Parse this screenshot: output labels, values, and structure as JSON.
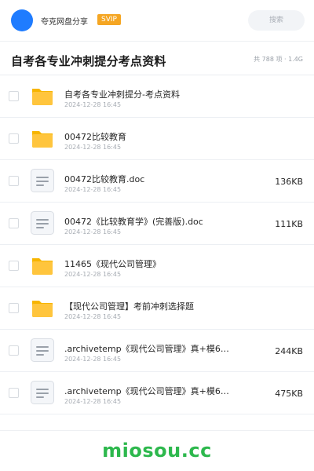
{
  "header": {
    "brand": "夸克网盘分享",
    "badge": "SVIP",
    "search_placeholder": "搜索"
  },
  "page": {
    "title": "自考各专业冲刺提分考点资料",
    "summary": "共 788 项 · 1.4G"
  },
  "files": [
    {
      "type": "folder",
      "name": "自考各专业冲刺提分-考点资料",
      "date": "2024-12-28 16:45",
      "size": ""
    },
    {
      "type": "folder",
      "name": "00472比较教育",
      "date": "2024-12-28 16:45",
      "size": ""
    },
    {
      "type": "file",
      "name": "00472比较教育.doc",
      "date": "2024-12-28 16:45",
      "size": "136KB"
    },
    {
      "type": "file",
      "name": "00472《比较教育学》(完善版).doc",
      "date": "2024-12-28 16:45",
      "size": "111KB"
    },
    {
      "type": "folder",
      "name": "11465《现代公司管理》",
      "date": "2024-12-28 16:45",
      "size": ""
    },
    {
      "type": "folder",
      "name": "【现代公司管理】考前冲刺选择题",
      "date": "2024-12-28 16:45",
      "size": ""
    },
    {
      "type": "file",
      "name": ".archivetemp《现代公司管理》真+模6套…",
      "date": "2024-12-28 16:45",
      "size": "244KB"
    },
    {
      "type": "file",
      "name": ".archivetemp《现代公司管理》真+模6套…",
      "date": "2024-12-28 16:45",
      "size": "475KB"
    }
  ],
  "watermark": "miosou.cc",
  "icons": {
    "folder": "folder-icon",
    "file": "document-icon"
  },
  "colors": {
    "accent": "#1f7cff",
    "badge": "#f5a623",
    "folder": "#ffc53d",
    "watermark": "#2db84d"
  }
}
